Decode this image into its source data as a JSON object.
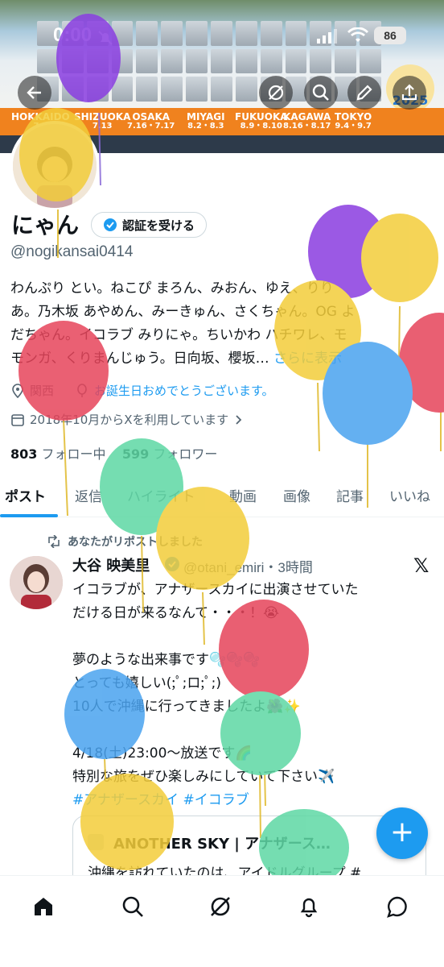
{
  "status_bar": {
    "time": "0:00",
    "battery": "86"
  },
  "banner": {
    "tour": [
      {
        "city": "HOKKAIDO",
        "date": "7.5"
      },
      {
        "city": "SHIZUOKA",
        "date": "7.13"
      },
      {
        "city": "OSAKA",
        "date": "7.16・7.17"
      },
      {
        "city": "MIYAGI",
        "date": "8.2・8.3"
      },
      {
        "city": "FUKUOKA",
        "date": "8.9・8.10"
      },
      {
        "city": "KAGAWA",
        "date": "8.16・8.17"
      },
      {
        "city": "TOKYO",
        "date": "9.4・9.7"
      }
    ],
    "year": "2025"
  },
  "profile": {
    "name": "にゃん",
    "verify_label": "認証を受ける",
    "handle": "@nogikansai0414",
    "bio_lines": [
      "わんぷり とい。ねこぴ まろん、みおん、ゆえ、りり",
      "あ。乃木坂 あやめん、みーきゅん、さくちゃん。OG よ",
      "だちゃん。イコラブ みりにゃ。ちいかわ ハチワレ、モ",
      "モンガ、くりまんじゅう。日向坂、櫻坂…"
    ],
    "bio_more": "さらに表示",
    "location": "関西",
    "birthday_link": "お誕生日おめでとうございます。",
    "joined": "2018年10月からXを利用しています",
    "following_count": "803",
    "following_label": "フォロー中",
    "followers_count": "599",
    "followers_label": "フォロワー"
  },
  "tabs": [
    "ポスト",
    "返信",
    "ハイライト",
    "動画",
    "画像",
    "記事",
    "いいね"
  ],
  "tweet": {
    "repost_label": "あなたがリポストしました",
    "author": "大谷 映美里",
    "handle": "@otani_emiri",
    "time": "・3時間",
    "lines": [
      "イコラブが、アナザースカイに出演させていた",
      "だける日が来るなんて・・・！😭",
      "",
      "夢のような出来事です🫧🫧🫧",
      "とっても嬉しい(;ﾟ;ロ;ﾟ;)",
      "10人で沖縄に行ってきましたよ🌺✨",
      "",
      "4/18(土)23:00〜放送です🌈",
      "特別な旅をぜひ楽しみにしていて下さい✈️"
    ],
    "hashtags": "#アナザースカイ #イコラブ",
    "card_title": "ANOTHER SKY | アナザース…",
    "card_desc": "沖縄を訪れていたのは、アイドルグループ #"
  },
  "colors": {
    "accent": "#1d9bf0",
    "text": "#0f1419",
    "muted": "#536471"
  }
}
